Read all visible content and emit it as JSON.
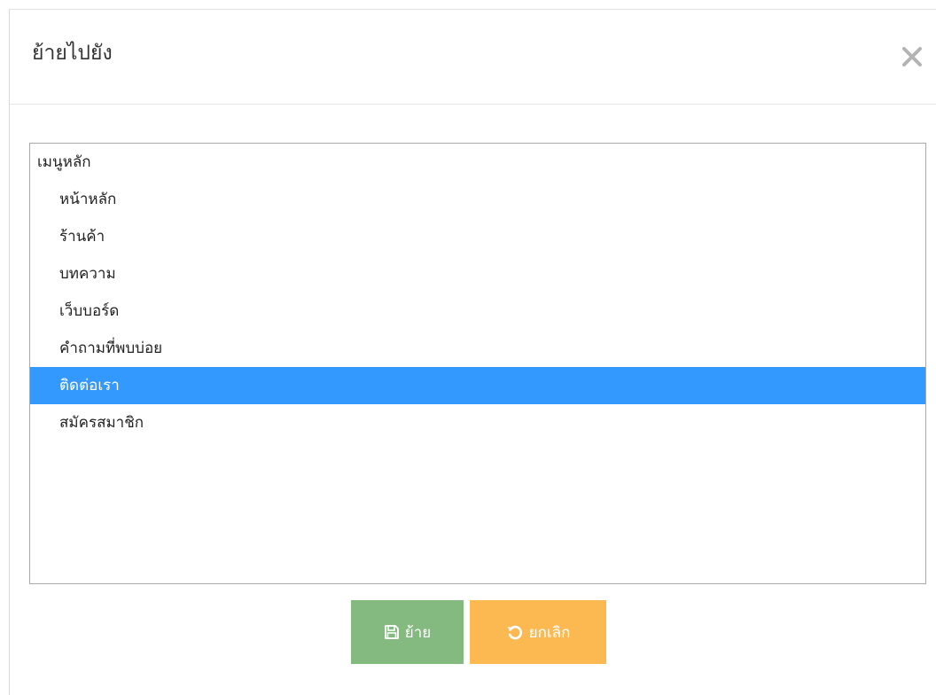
{
  "dialog": {
    "title": "ย้ายไปยัง",
    "close_icon": "close-icon"
  },
  "menu_list": {
    "items": [
      {
        "label": "เมนูหลัก",
        "level": 0,
        "selected": false
      },
      {
        "label": "หน้าหลัก",
        "level": 1,
        "selected": false
      },
      {
        "label": "ร้านค้า",
        "level": 1,
        "selected": false
      },
      {
        "label": "บทความ",
        "level": 1,
        "selected": false
      },
      {
        "label": "เว็บบอร์ด",
        "level": 1,
        "selected": false
      },
      {
        "label": "คำถามที่พบบ่อย",
        "level": 1,
        "selected": false
      },
      {
        "label": "ติดต่อเรา",
        "level": 1,
        "selected": true
      },
      {
        "label": "สมัครสมาชิก",
        "level": 1,
        "selected": false
      }
    ],
    "selected_color": "#3399ff"
  },
  "buttons": {
    "move": {
      "label": "ย้าย",
      "icon": "save-icon",
      "color": "#84b97f"
    },
    "cancel": {
      "label": "ยกเลิก",
      "icon": "undo-icon",
      "color": "#fcb951"
    }
  }
}
